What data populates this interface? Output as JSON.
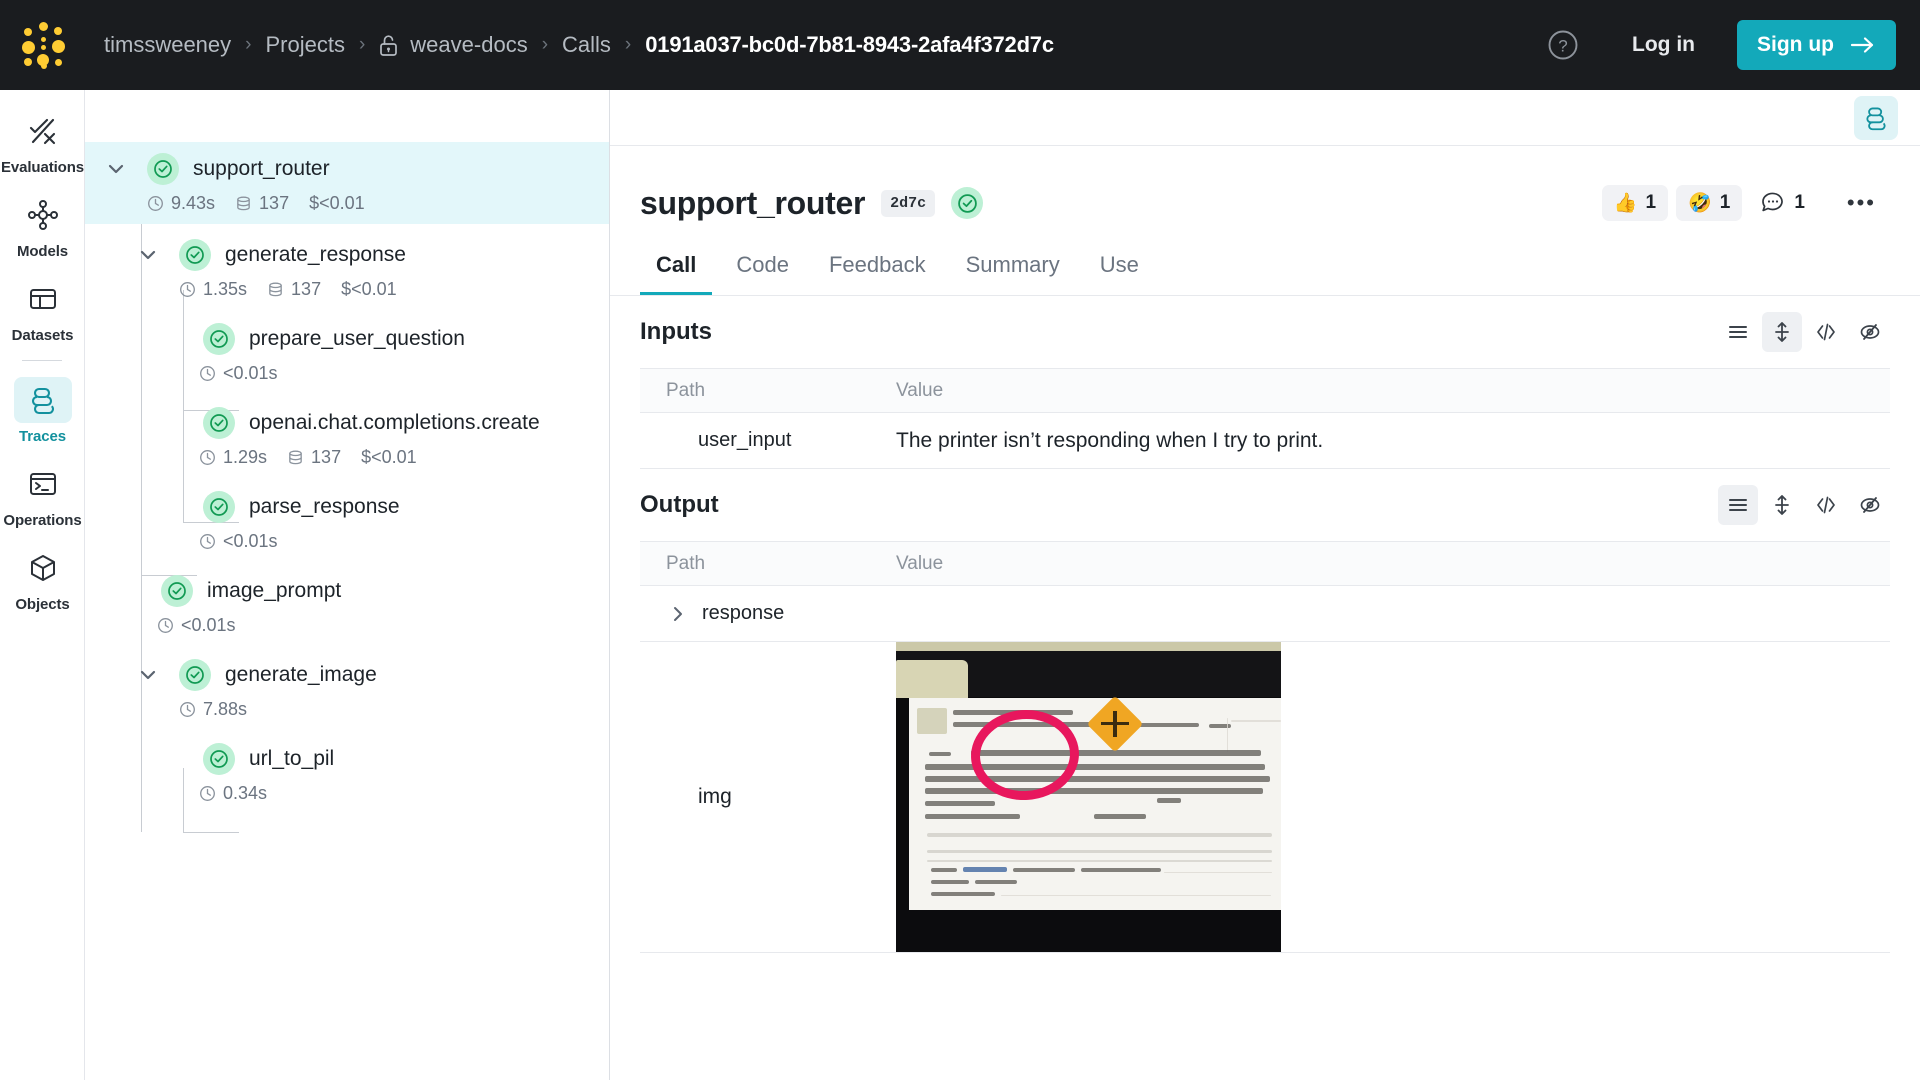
{
  "header": {
    "logo_icon": "wandb-logo-icon",
    "breadcrumb": [
      {
        "label": "timssweeney",
        "icon": null,
        "active": false
      },
      {
        "label": "Projects",
        "icon": null,
        "active": false
      },
      {
        "label": "weave-docs",
        "icon": "unlock-icon",
        "active": false
      },
      {
        "label": "Calls",
        "icon": null,
        "active": false
      },
      {
        "label": "0191a037-bc0d-7b81-8943-2afa4f372d7c",
        "icon": null,
        "active": true
      }
    ],
    "separator": "›",
    "help_icon": "question-circle-icon",
    "login_label": "Log in",
    "signup_label": "Sign up",
    "signup_arrow": "→",
    "accent_color": "#13a9ba",
    "bg_color": "#1a1c1f"
  },
  "sidebar": {
    "items": [
      {
        "label": "Evaluations",
        "icon": "evaluations-icon",
        "active": false
      },
      {
        "label": "Models",
        "icon": "models-icon",
        "active": false
      },
      {
        "label": "Datasets",
        "icon": "datasets-icon",
        "active": false
      },
      {
        "label": "Traces",
        "icon": "traces-icon",
        "active": true
      },
      {
        "label": "Operations",
        "icon": "operations-icon",
        "active": false
      },
      {
        "label": "Objects",
        "icon": "objects-icon",
        "active": false
      }
    ]
  },
  "trace_tree": {
    "nodes": [
      {
        "name": "support_router",
        "duration": "9.43s",
        "tokens": "137",
        "cost": "$<0.01",
        "depth": 0,
        "selected": true,
        "expanded": true
      },
      {
        "name": "generate_response",
        "duration": "1.35s",
        "tokens": "137",
        "cost": "$<0.01",
        "depth": 1,
        "selected": false,
        "expanded": true
      },
      {
        "name": "prepare_user_question",
        "duration": "<0.01s",
        "tokens": null,
        "cost": null,
        "depth": 2,
        "selected": false,
        "expanded": false
      },
      {
        "name": "openai.chat.completions.create",
        "duration": "1.29s",
        "tokens": "137",
        "cost": "$<0.01",
        "depth": 2,
        "selected": false,
        "expanded": false
      },
      {
        "name": "parse_response",
        "duration": "<0.01s",
        "tokens": null,
        "cost": null,
        "depth": 2,
        "selected": false,
        "expanded": false
      },
      {
        "name": "image_prompt",
        "duration": "<0.01s",
        "tokens": null,
        "cost": null,
        "depth": 1,
        "selected": false,
        "expanded": false
      },
      {
        "name": "generate_image",
        "duration": "7.88s",
        "tokens": null,
        "cost": null,
        "depth": 1,
        "selected": false,
        "expanded": true
      },
      {
        "name": "url_to_pil",
        "duration": "0.34s",
        "tokens": null,
        "cost": null,
        "depth": 2,
        "selected": false,
        "expanded": false
      }
    ]
  },
  "call_detail": {
    "panel_toggle_icon": "traces-icon",
    "title": "support_router",
    "version_badge": "2d7c",
    "status_icon": "success-check-icon",
    "reactions": [
      {
        "emoji": "👍",
        "name": "thumbs-up-reaction",
        "count": "1"
      },
      {
        "emoji": "🤣",
        "name": "rofl-reaction",
        "count": "1"
      },
      {
        "emoji": "comment",
        "name": "comment-count",
        "count": "1"
      }
    ],
    "more_label": "•••",
    "tabs": [
      {
        "label": "Call",
        "active": true
      },
      {
        "label": "Code",
        "active": false
      },
      {
        "label": "Feedback",
        "active": false
      },
      {
        "label": "Summary",
        "active": false
      },
      {
        "label": "Use",
        "active": false
      }
    ],
    "inputs": {
      "title": "Inputs",
      "tools": [
        {
          "name": "list-view-icon",
          "glyph": "lines",
          "active": false
        },
        {
          "name": "expand-rows-icon",
          "glyph": "updown",
          "active": true
        },
        {
          "name": "code-view-icon",
          "glyph": "code",
          "active": false
        },
        {
          "name": "hide-empty-icon",
          "glyph": "eye-off",
          "active": false
        }
      ],
      "columns": [
        "Path",
        "Value"
      ],
      "rows": [
        {
          "path": "user_input",
          "value": "The printer isn’t responding when I try to print."
        }
      ]
    },
    "output": {
      "title": "Output",
      "tools": [
        {
          "name": "list-view-icon",
          "glyph": "lines",
          "active": true
        },
        {
          "name": "expand-rows-icon",
          "glyph": "updown",
          "active": false
        },
        {
          "name": "code-view-icon",
          "glyph": "code",
          "active": false
        },
        {
          "name": "hide-empty-icon",
          "glyph": "eye-off",
          "active": false
        }
      ],
      "columns": [
        "Path",
        "Value"
      ],
      "rows": [
        {
          "path": "response",
          "value": "",
          "expandable": true
        },
        {
          "path": "img",
          "value": "",
          "expandable": false,
          "is_image": true
        }
      ]
    }
  }
}
